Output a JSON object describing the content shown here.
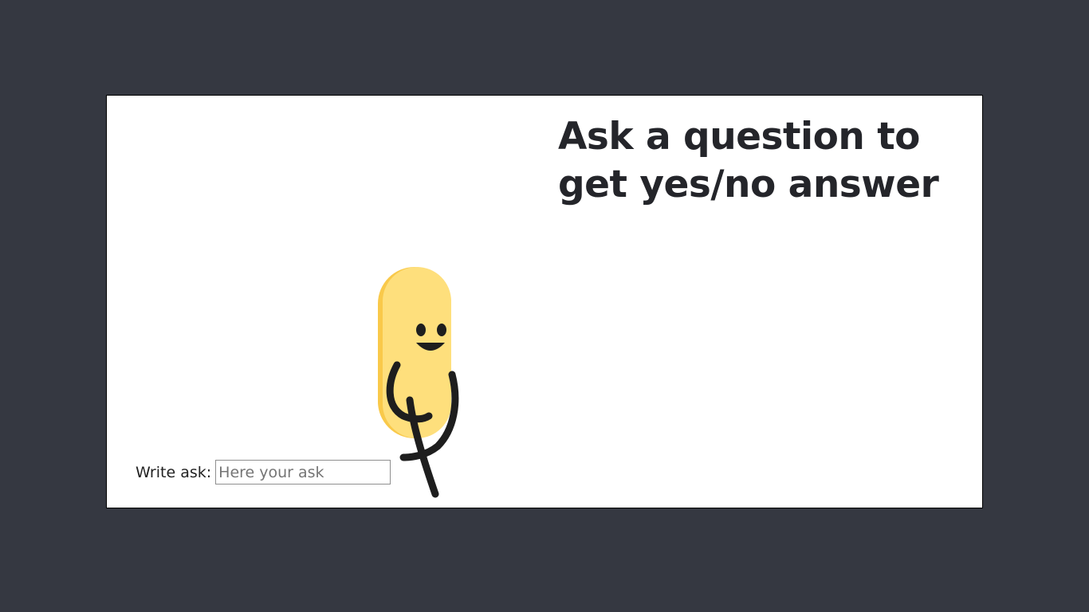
{
  "heading": {
    "title": "Ask a question to get yes/no answer"
  },
  "ask_form": {
    "label": "Write ask:",
    "input_value": "",
    "input_placeholder": "Here your ask"
  },
  "mascot": {
    "icon": "bean-character-icon",
    "body_color": "#fedf7c",
    "shade_color": "#f9c94a",
    "line_color": "#1e1e1e"
  },
  "colors": {
    "background": "#353841",
    "card": "#ffffff",
    "text": "#24252a"
  }
}
